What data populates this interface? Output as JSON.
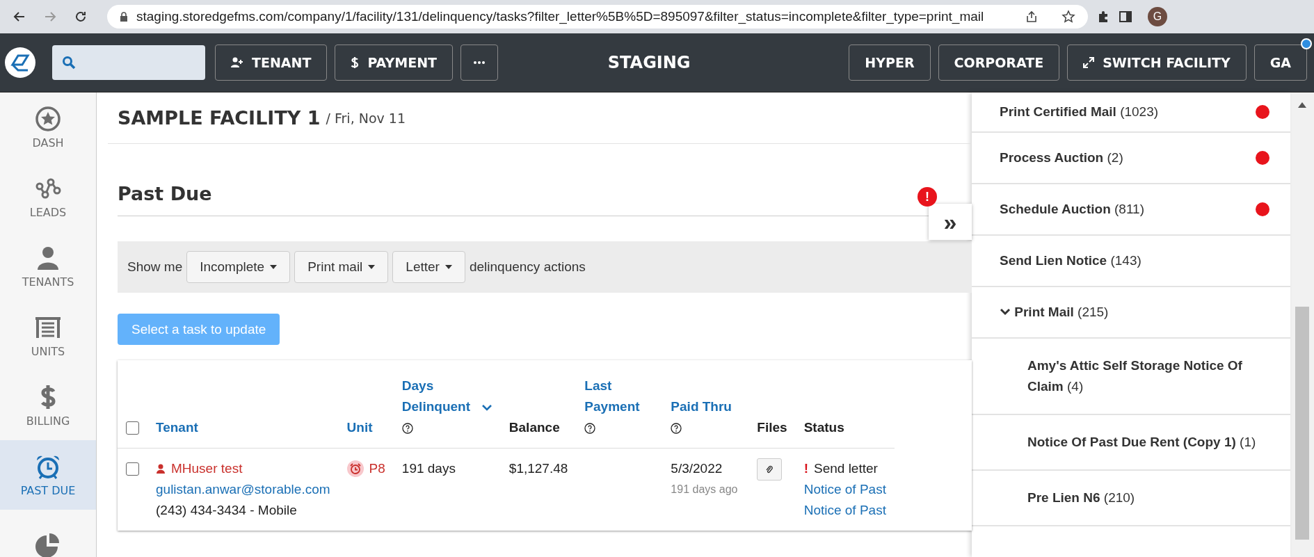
{
  "browser": {
    "url": "staging.storedgefms.com/company/1/facility/131/delinquency/tasks?filter_letter%5B%5D=895097&filter_status=incomplete&filter_type=print_mail",
    "profile_initial": "G"
  },
  "header": {
    "left_buttons": [
      {
        "kind": "add-person",
        "label": "TENANT"
      },
      {
        "kind": "dollar",
        "label": "PAYMENT"
      },
      {
        "kind": "more"
      }
    ],
    "title": "STAGING",
    "right_buttons": [
      {
        "kind": "plain",
        "label": "HYPER"
      },
      {
        "kind": "plain",
        "label": "CORPORATE"
      },
      {
        "kind": "switch",
        "label": "SWITCH FACILITY"
      },
      {
        "kind": "user",
        "label": "GA",
        "notification": true
      }
    ]
  },
  "sidebar": {
    "items": [
      {
        "label": "DASH",
        "selected": false
      },
      {
        "label": "LEADS",
        "selected": false
      },
      {
        "label": "TENANTS",
        "selected": false
      },
      {
        "label": "UNITS",
        "selected": false
      },
      {
        "label": "BILLING",
        "selected": false
      },
      {
        "label": "PAST DUE",
        "selected": true
      },
      {
        "selected": false
      }
    ]
  },
  "page": {
    "facility": "SAMPLE FACILITY 1",
    "date": "/ Fri, Nov 11",
    "section": "Past Due",
    "filters": {
      "prefix": "Show me",
      "dropdowns": [
        "Incomplete",
        "Print mail",
        "Letter"
      ],
      "suffix": "delinquency actions"
    },
    "action_button": {
      "label": "Select a task to update",
      "disabled": true
    }
  },
  "table": {
    "columns": [
      {
        "kind": "check",
        "checked": false
      },
      {
        "kind": "link",
        "label": "Tenant"
      },
      {
        "kind": "link",
        "label": "Unit"
      },
      {
        "kind": "sorted",
        "label": "Days Delinquent",
        "help": true
      },
      {
        "kind": "plain",
        "label": "Balance"
      },
      {
        "kind": "link",
        "label": "Last Payment",
        "help": true
      },
      {
        "kind": "link",
        "label": "Paid Thru",
        "help": true
      },
      {
        "kind": "plain",
        "label": "Files"
      },
      {
        "kind": "plain",
        "label": "Status"
      }
    ],
    "rows": [
      {
        "checked": false,
        "tenant": "MHuser test",
        "email": "gulistan.anwar@storable.com",
        "phone": "(243) 434-3434 - Mobile",
        "unit": "P8",
        "days": "191 days",
        "balance": "$1,127.48",
        "paid_thru": "5/3/2022",
        "paid_thru_ago": "191 days ago",
        "status": "Send letter",
        "status_links": [
          "Notice of Past",
          "Notice of Past"
        ]
      }
    ]
  },
  "drawer": {
    "toggle": "»",
    "alert": "!",
    "items": [
      {
        "name": "Print Certified Mail",
        "count": "(1023)",
        "alert": true
      },
      {
        "name": "Process Auction",
        "count": "(2)",
        "alert": true
      },
      {
        "name": "Schedule Auction",
        "count": "(811)",
        "alert": true
      },
      {
        "name": "Send Lien Notice",
        "count": "(143)",
        "alert": false
      },
      {
        "name": "Print Mail",
        "count": "(215)",
        "alert": false,
        "expanded": true,
        "children": [
          {
            "name": "Amy's Attic Self Storage Notice Of Claim",
            "count": "(4)",
            "alert": false
          },
          {
            "name": "Notice Of Past Due Rent (Copy 1)",
            "count": "(1)",
            "alert": false
          },
          {
            "name": "Pre Lien N6",
            "count": "(210)",
            "alert": false
          }
        ]
      }
    ]
  }
}
